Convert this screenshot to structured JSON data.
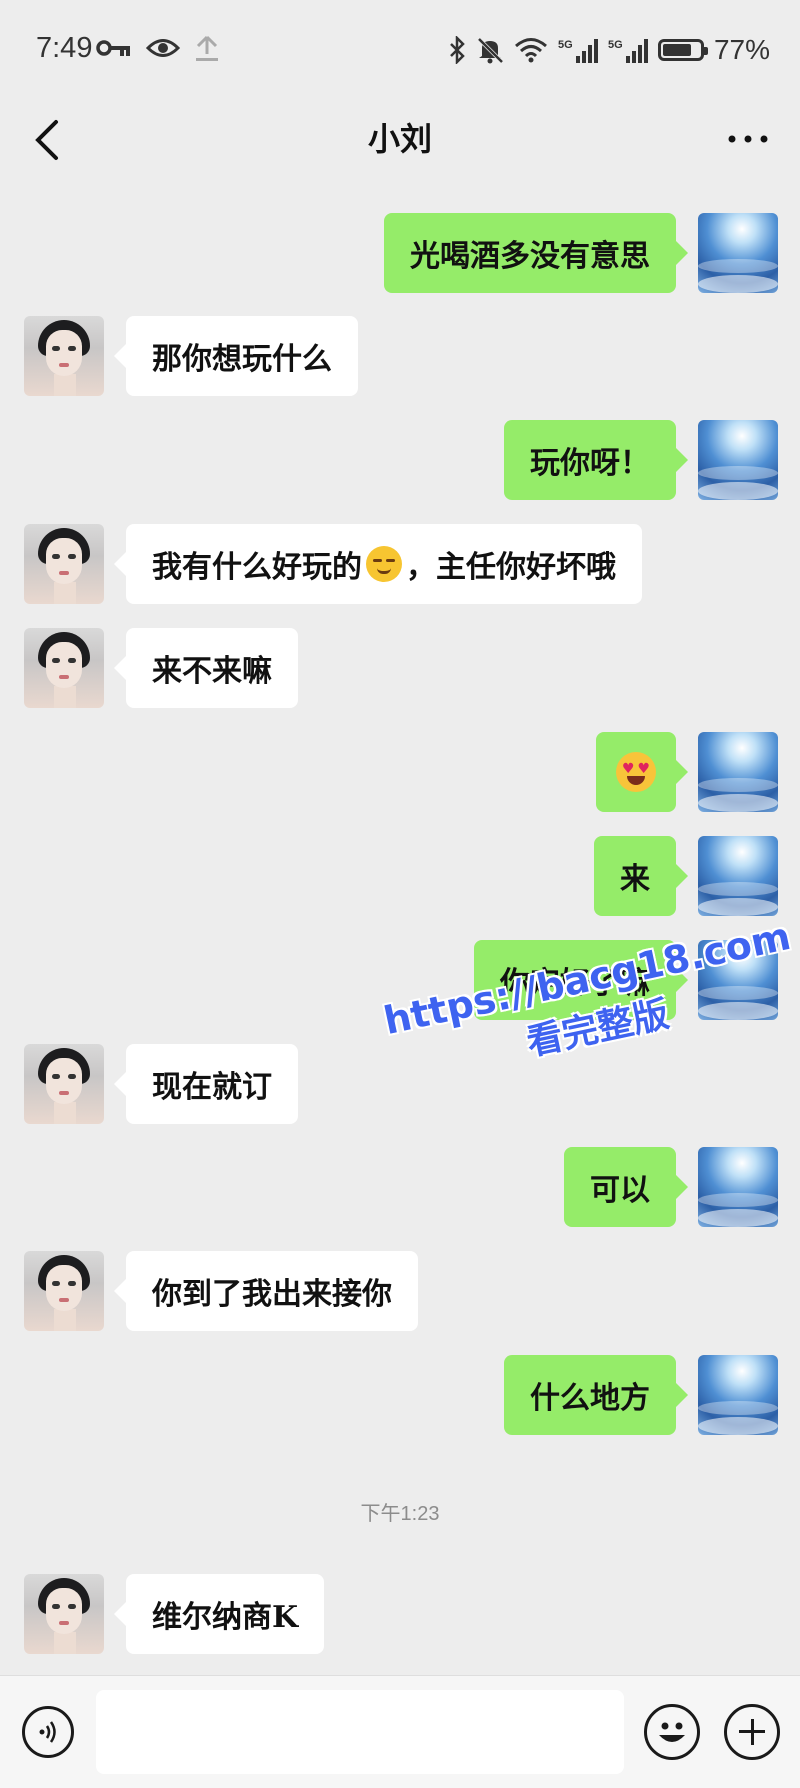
{
  "status_bar": {
    "time": "7:49",
    "battery_text": "77%",
    "battery_level": 0.77,
    "icons": [
      "vpn-key-icon",
      "eye-icon",
      "upload-icon",
      "bluetooth-icon",
      "mute-icon",
      "wifi-icon",
      "signal-5g-icon",
      "signal-5g-icon",
      "battery-icon"
    ]
  },
  "nav": {
    "title": "小刘",
    "back_icon": "chevron-left-icon",
    "more_icon": "more-icon"
  },
  "messages": [
    {
      "side": "right",
      "text": "光喝酒多没有意思"
    },
    {
      "side": "left",
      "text": "那你想玩什么"
    },
    {
      "side": "right",
      "text": "玩你呀！"
    },
    {
      "side": "left",
      "text_before": "我有什么好玩的",
      "emoji": "smiling-face-emoji",
      "text_after": "，主任你好坏哦"
    },
    {
      "side": "left",
      "text": "来不来嘛"
    },
    {
      "side": "right",
      "emoji": "heart-eyes-emoji"
    },
    {
      "side": "right",
      "text": "来"
    },
    {
      "side": "right",
      "text": "你定好了嘛"
    },
    {
      "side": "left",
      "text": "现在就订"
    },
    {
      "side": "right",
      "text": "可以"
    },
    {
      "side": "left",
      "text": "你到了我出来接你"
    },
    {
      "side": "right",
      "text": "什么地方"
    },
    {
      "side": "left",
      "text": "维尔纳商K"
    }
  ],
  "timestamp": "下午1:23",
  "watermark": {
    "url": "https://bacg18.com",
    "sub": "看完整版"
  },
  "input_bar": {
    "voice_icon": "voice-icon",
    "emoji_icon": "emoji-icon",
    "plus_icon": "plus-icon",
    "text_value": ""
  },
  "colors": {
    "background": "#ededed",
    "sent_bubble": "#95ec69",
    "received_bubble": "#ffffff",
    "watermark": "#3e63f0"
  }
}
